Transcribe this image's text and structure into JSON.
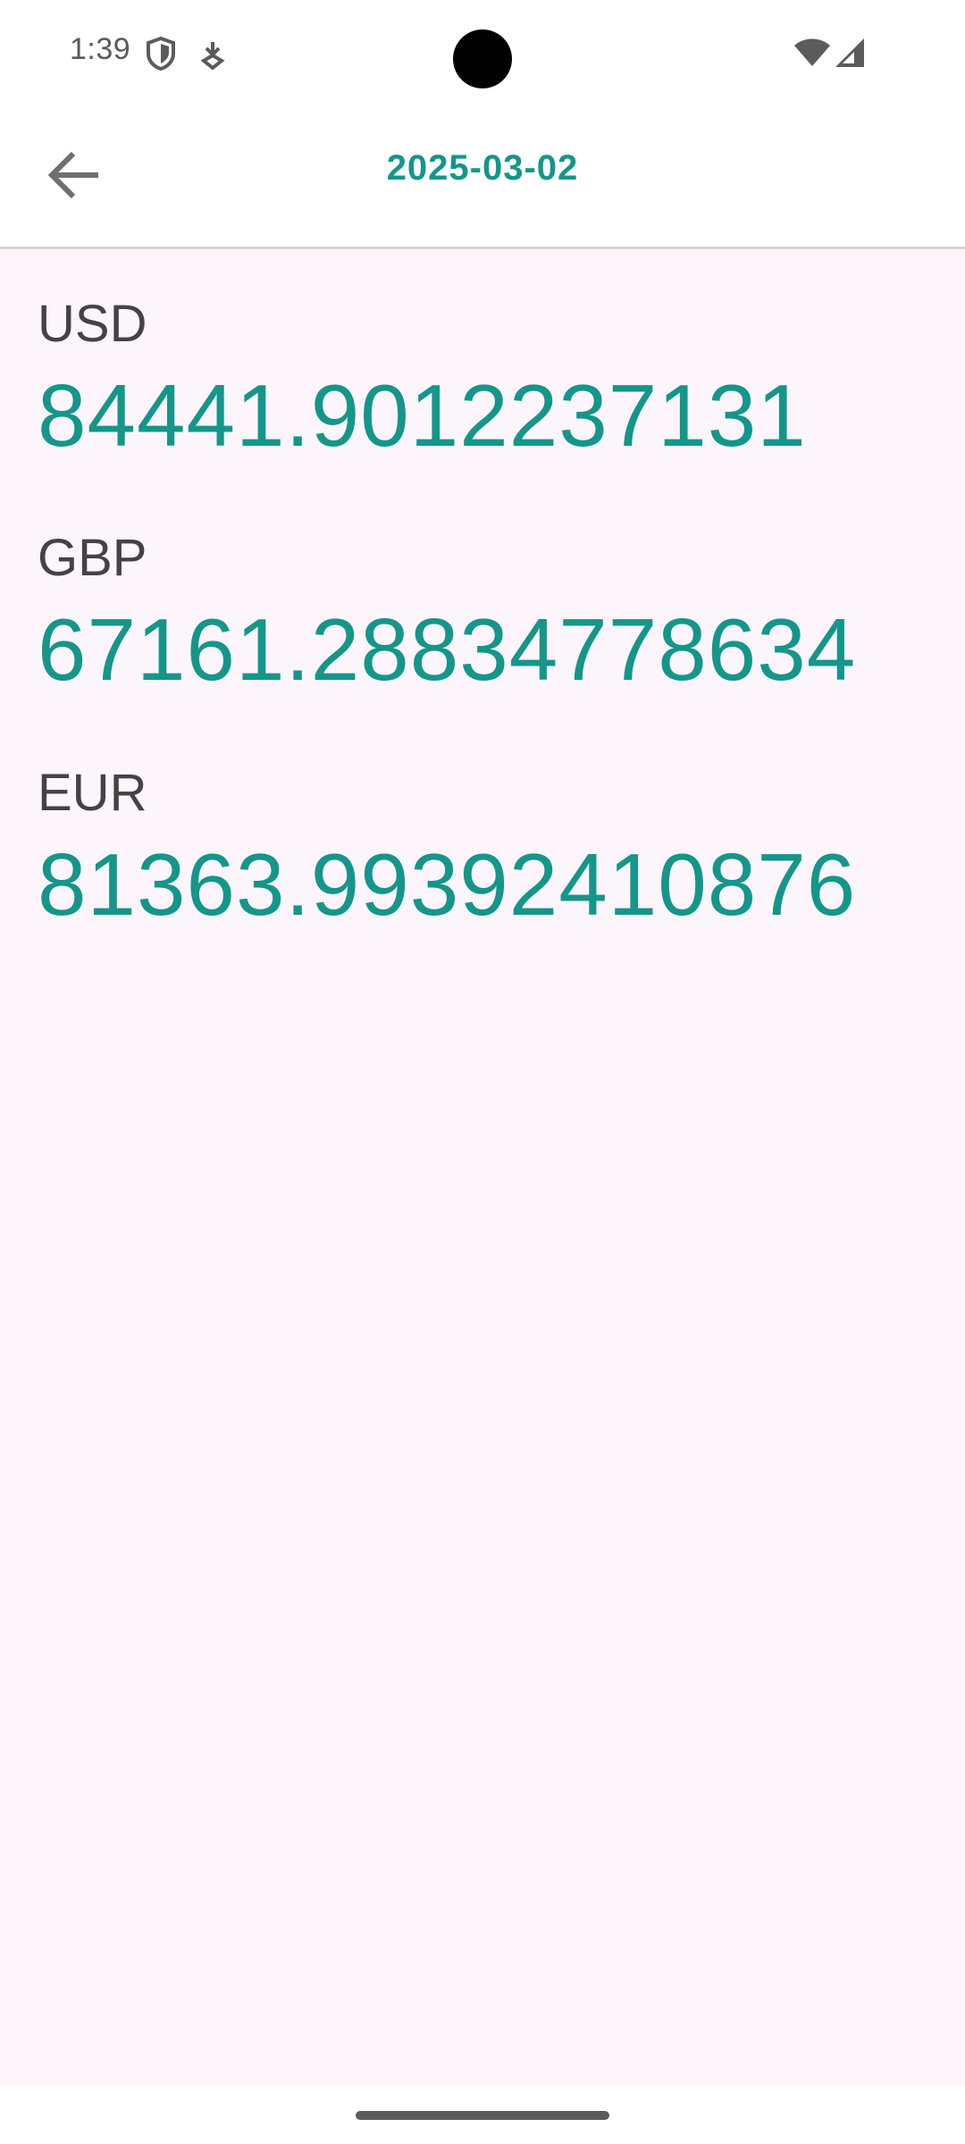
{
  "status_bar": {
    "time": "1:39",
    "icons": [
      "shield-icon",
      "download-icon",
      "wifi-icon",
      "signal-icon"
    ]
  },
  "app_bar": {
    "back_icon": "arrow-back-icon",
    "title": "2025-03-02"
  },
  "rates": [
    {
      "code": "USD",
      "value": "84441.9012237131"
    },
    {
      "code": "GBP",
      "value": "67161.28834778634"
    },
    {
      "code": "EUR",
      "value": "81363.99392410876"
    }
  ],
  "colors": {
    "accent": "#14968a",
    "background": "#fcf5fc",
    "label": "#444244"
  }
}
